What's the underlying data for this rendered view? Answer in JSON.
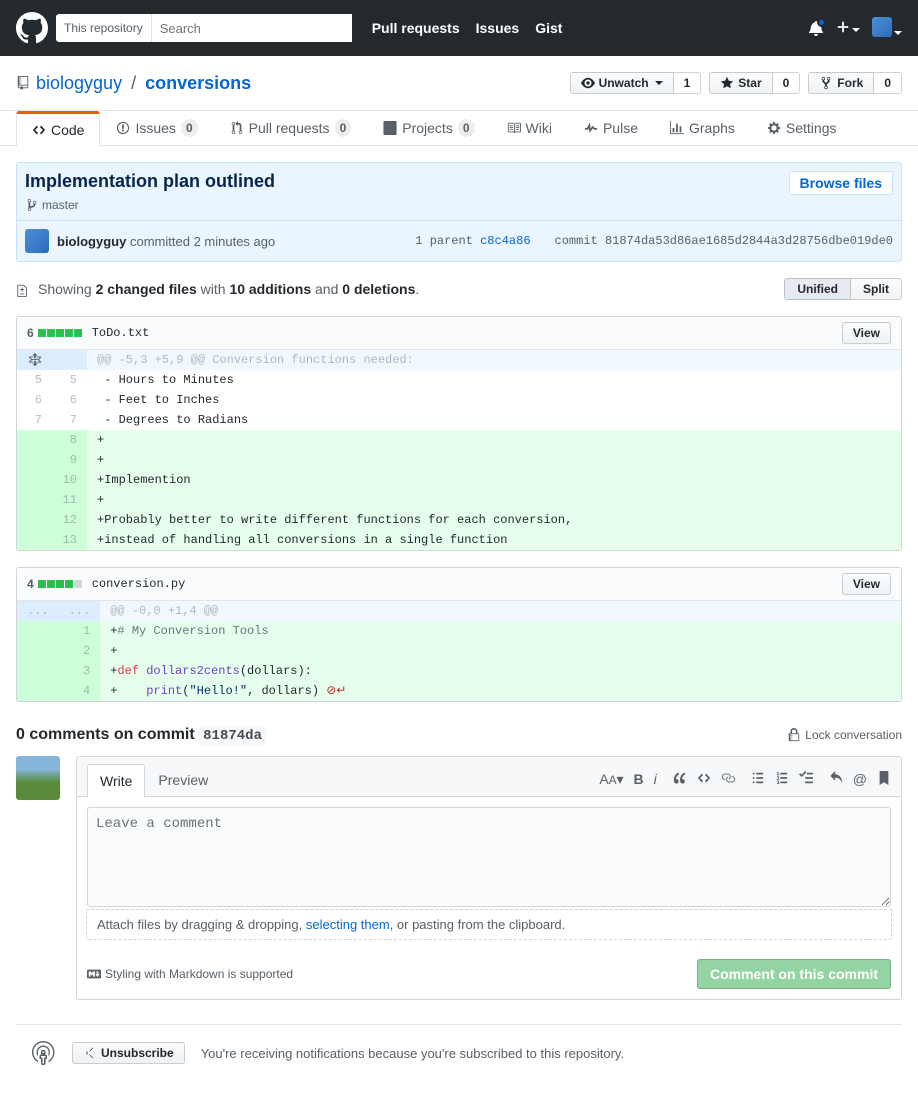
{
  "header": {
    "search_scope": "This repository",
    "search_placeholder": "Search",
    "nav": {
      "pulls": "Pull requests",
      "issues": "Issues",
      "gist": "Gist"
    }
  },
  "repo": {
    "owner": "biologyguy",
    "separator": "/",
    "name": "conversions",
    "actions": {
      "unwatch": "Unwatch",
      "unwatch_count": "1",
      "star": "Star",
      "star_count": "0",
      "fork": "Fork",
      "fork_count": "0"
    }
  },
  "tabs": {
    "code": "Code",
    "issues": "Issues",
    "issues_count": "0",
    "pulls": "Pull requests",
    "pulls_count": "0",
    "projects": "Projects",
    "projects_count": "0",
    "wiki": "Wiki",
    "pulse": "Pulse",
    "graphs": "Graphs",
    "settings": "Settings"
  },
  "commit": {
    "title": "Implementation plan outlined",
    "branch": "master",
    "browse_files": "Browse files",
    "author": "biologyguy",
    "committed_text": "committed",
    "time": "2 minutes ago",
    "parent_label": "1 parent",
    "parent_sha": "c8c4a86",
    "commit_label": "commit",
    "full_sha": "81874da53d86ae1685d2844a3d28756dbe019de0"
  },
  "summary": {
    "showing": "Showing",
    "changed_files_link": "2 changed files",
    "with": "with",
    "additions": "10 additions",
    "and": "and",
    "deletions": "0 deletions",
    "period": ".",
    "unified": "Unified",
    "split": "Split"
  },
  "files": [
    {
      "count": "6",
      "blocks_add": 5,
      "blocks_neutral": 0,
      "name": "ToDo.txt",
      "view": "View",
      "hunk": "@@ -5,3 +5,9 @@ Conversion functions needed:",
      "rows": [
        {
          "type": "ctx",
          "l": "5",
          "r": "5",
          "text": " - Hours to Minutes"
        },
        {
          "type": "ctx",
          "l": "6",
          "r": "6",
          "text": " - Feet to Inches"
        },
        {
          "type": "ctx",
          "l": "7",
          "r": "7",
          "text": " - Degrees to Radians"
        },
        {
          "type": "add",
          "l": "",
          "r": "8",
          "text": "+"
        },
        {
          "type": "add",
          "l": "",
          "r": "9",
          "text": "+"
        },
        {
          "type": "add",
          "l": "",
          "r": "10",
          "text": "+Implemention"
        },
        {
          "type": "add",
          "l": "",
          "r": "11",
          "text": "+"
        },
        {
          "type": "add",
          "l": "",
          "r": "12",
          "text": "+Probably better to write different functions for each conversion,"
        },
        {
          "type": "add",
          "l": "",
          "r": "13",
          "text": "+instead of handling all conversions in a single function"
        }
      ]
    },
    {
      "count": "4",
      "blocks_add": 4,
      "blocks_neutral": 1,
      "name": "conversion.py",
      "view": "View",
      "hunk": "@@ -0,0 +1,4 @@",
      "dots": "...",
      "rows": [
        {
          "type": "add",
          "l": "",
          "r": "1",
          "html": "+<span class='syn-c'># My Conversion Tools</span>"
        },
        {
          "type": "add",
          "l": "",
          "r": "2",
          "html": "+"
        },
        {
          "type": "add",
          "l": "",
          "r": "3",
          "html": "+<span class='syn-k'>def</span> <span class='syn-f'>dollars2cents</span>(dollars):"
        },
        {
          "type": "add",
          "l": "",
          "r": "4",
          "html": "+    <span class='syn-f'>print</span>(<span class='syn-s'>\"Hello!\"</span>, dollars) <span class='no-newline'>⊘↵</span>"
        }
      ]
    }
  ],
  "comments": {
    "title_count": "0 comments on commit",
    "short_sha": "81874da",
    "lock": "Lock conversation",
    "write": "Write",
    "preview": "Preview",
    "placeholder": "Leave a comment",
    "attach_pre": "Attach files by dragging & dropping, ",
    "attach_link": "selecting them",
    "attach_post": ", or pasting from the clipboard.",
    "md_hint": "Styling with Markdown is supported",
    "submit": "Comment on this commit"
  },
  "subscribe": {
    "button": "Unsubscribe",
    "text": "You're receiving notifications because you're subscribed to this repository."
  }
}
